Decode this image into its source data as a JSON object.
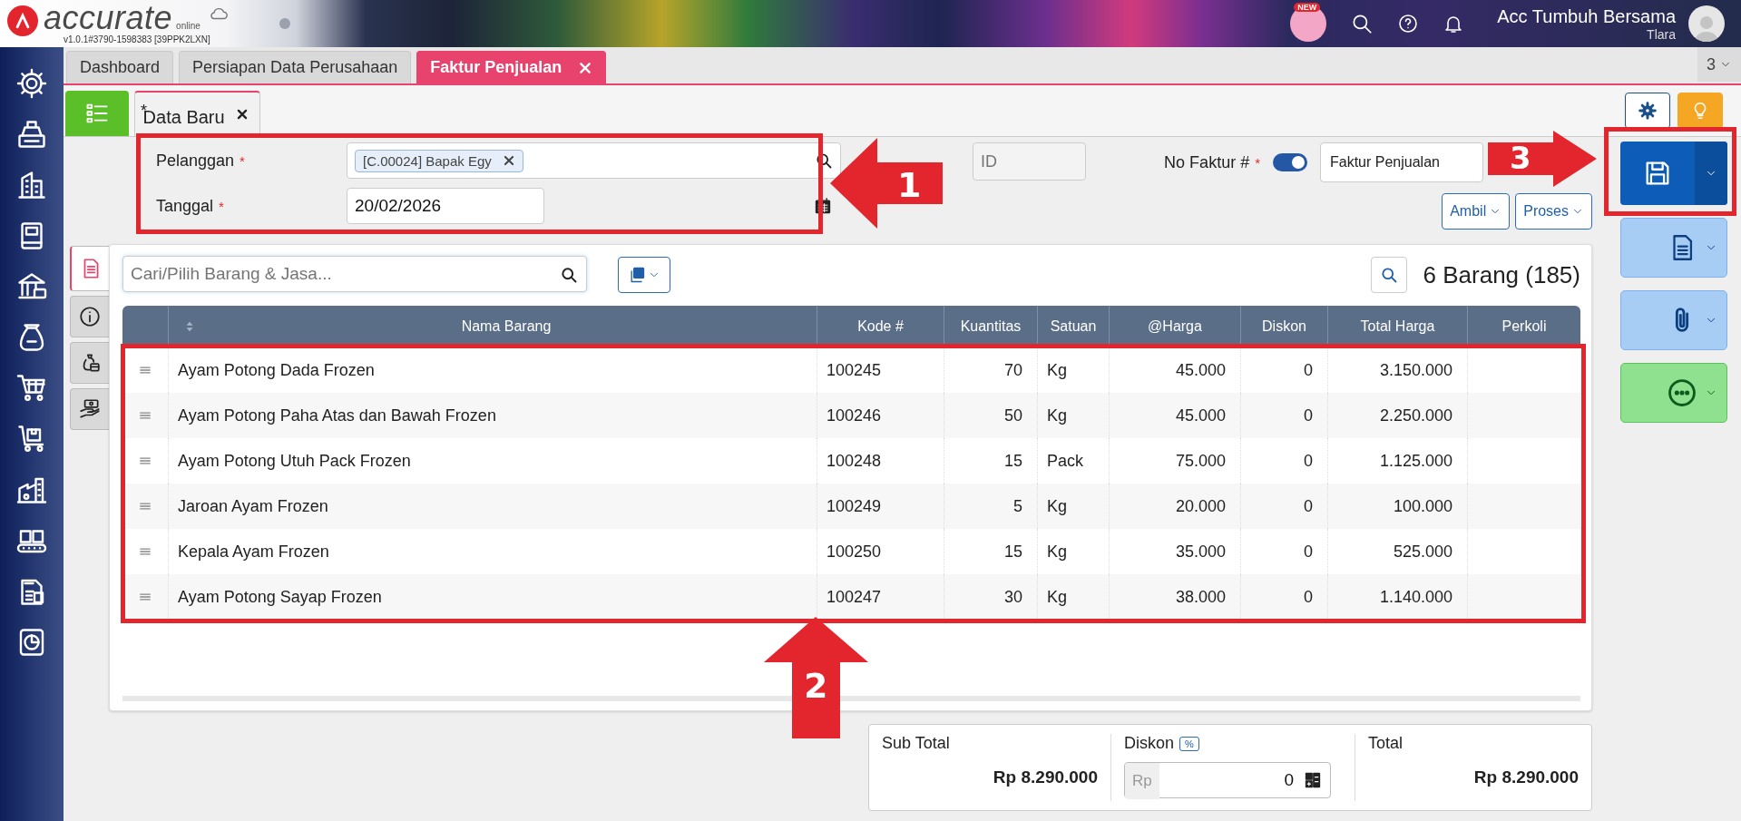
{
  "app": {
    "logo": "accurate",
    "logo_sub": "online",
    "version": "v1.0.1#3790-1598383 [39PPK2LXN]",
    "new_badge": "NEW",
    "company": "Acc Tumbuh Bersama",
    "user": "Tlara"
  },
  "tabs": [
    {
      "label": "Dashboard",
      "selected": false
    },
    {
      "label": "Persiapan Data Perusahaan",
      "selected": false
    },
    {
      "label": "Faktur Penjualan",
      "selected": true
    }
  ],
  "tab_count": "3",
  "doc_tab": {
    "mark": "*",
    "label": "Data Baru"
  },
  "form": {
    "customer": {
      "label": "Pelanggan",
      "required_mark": "*",
      "value": "[C.00024] Bapak Egy"
    },
    "date": {
      "label": "Tanggal",
      "required_mark": "*",
      "value": "20/02/2026"
    },
    "id_placeholder": "ID",
    "invoice": {
      "label": "No Faktur #",
      "required_mark": "*",
      "auto_number": true,
      "type": "Faktur Penjualan"
    },
    "buttons": [
      "Ambil",
      "Proses"
    ]
  },
  "side_tabs": [
    {
      "kind": "detail",
      "selected": true
    },
    {
      "kind": "info",
      "selected": false
    },
    {
      "kind": "cost",
      "selected": false
    },
    {
      "kind": "payment",
      "selected": false
    }
  ],
  "items": {
    "search_placeholder": "Cari/Pilih Barang & Jasa...",
    "count": "6 Barang (185)",
    "columns": [
      "Nama Barang",
      "Kode #",
      "Kuantitas",
      "Satuan",
      "@Harga",
      "Diskon",
      "Total Harga",
      "Perkoli"
    ],
    "rows": [
      {
        "name": "Ayam Potong Dada Frozen",
        "code": "100245",
        "qty": "70",
        "unit": "Kg",
        "price": "45.000",
        "discount": "0",
        "total": "3.150.000"
      },
      {
        "name": "Ayam Potong Paha Atas dan Bawah Frozen",
        "code": "100246",
        "qty": "50",
        "unit": "Kg",
        "price": "45.000",
        "discount": "0",
        "total": "2.250.000"
      },
      {
        "name": "Ayam Potong Utuh Pack Frozen",
        "code": "100248",
        "qty": "15",
        "unit": "Pack",
        "price": "75.000",
        "discount": "0",
        "total": "1.125.000"
      },
      {
        "name": "Jaroan Ayam Frozen",
        "code": "100249",
        "qty": "5",
        "unit": "Kg",
        "price": "20.000",
        "discount": "0",
        "total": "100.000"
      },
      {
        "name": "Kepala Ayam Frozen",
        "code": "100250",
        "qty": "15",
        "unit": "Kg",
        "price": "35.000",
        "discount": "0",
        "total": "525.000"
      },
      {
        "name": "Ayam Potong Sayap Frozen",
        "code": "100247",
        "qty": "30",
        "unit": "Kg",
        "price": "38.000",
        "discount": "0",
        "total": "1.140.000"
      }
    ]
  },
  "summary": {
    "subtotal_label": "Sub Total",
    "subtotal": "Rp 8.290.000",
    "discount_label": "Diskon",
    "discount_mode": "%",
    "currency": "Rp",
    "discount_value": "0",
    "total_label": "Total",
    "total": "Rp 8.290.000"
  },
  "annotations": [
    {
      "number": "1"
    },
    {
      "number": "2"
    },
    {
      "number": "3"
    }
  ]
}
